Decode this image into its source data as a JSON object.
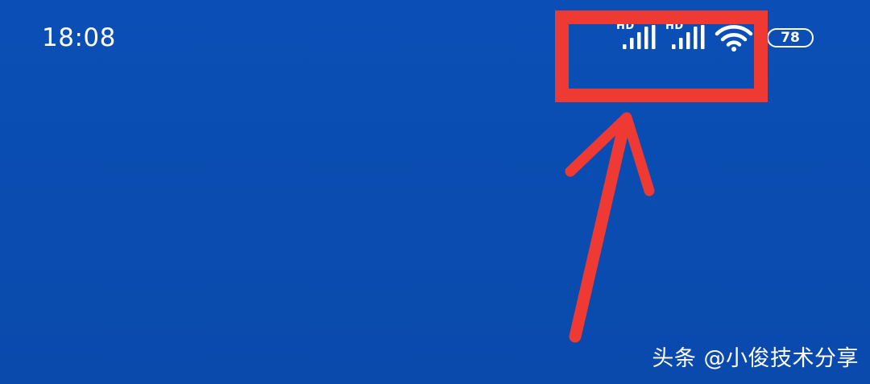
{
  "status_bar": {
    "time": "18:08",
    "signal_1": {
      "label": "HD",
      "icon": "cellular-signal-icon"
    },
    "signal_2": {
      "label": "HD",
      "icon": "cellular-signal-icon"
    },
    "wifi": {
      "icon": "wifi-icon"
    },
    "battery": {
      "level": "78",
      "icon": "battery-icon"
    }
  },
  "annotation": {
    "color": "#ef3a33",
    "highlight": "red-highlight-box",
    "pointer": "red-arrow-icon"
  },
  "watermark": "头条 @小俊技术分享",
  "colors": {
    "background": "#0b4eb3",
    "foreground": "#ffffff"
  }
}
